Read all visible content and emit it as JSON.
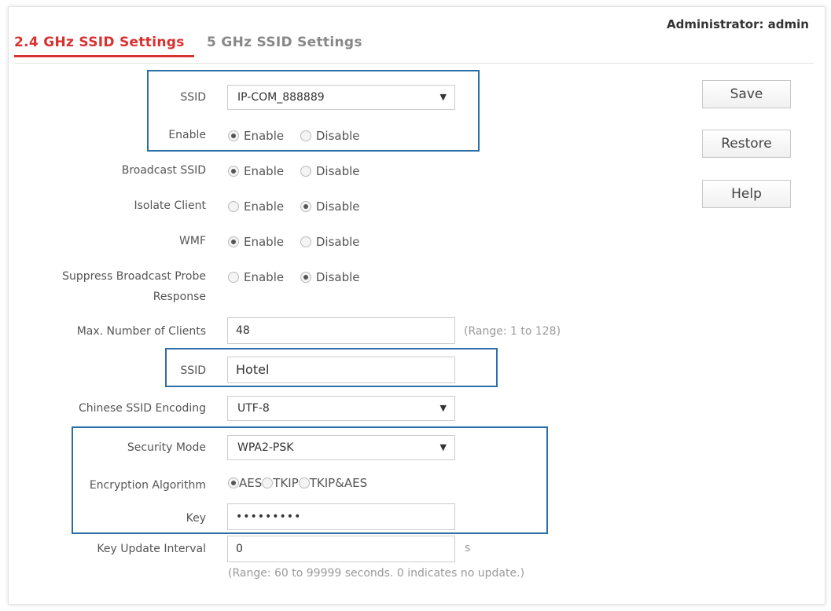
{
  "header": {
    "admin_text": "Administrator: admin"
  },
  "tabs": [
    {
      "label": "2.4 GHz SSID Settings",
      "active": true
    },
    {
      "label": "5 GHz SSID Settings",
      "active": false
    }
  ],
  "form": {
    "ssid_select": {
      "label": "SSID",
      "value": "IP-COM_888889"
    },
    "enable": {
      "label": "Enable",
      "options": [
        "Enable",
        "Disable"
      ],
      "selected": "Enable"
    },
    "broadcast_ssid": {
      "label": "Broadcast SSID",
      "options": [
        "Enable",
        "Disable"
      ],
      "selected": "Enable"
    },
    "isolate_client": {
      "label": "Isolate Client",
      "options": [
        "Enable",
        "Disable"
      ],
      "selected": "Disable"
    },
    "wmf": {
      "label": "WMF",
      "options": [
        "Enable",
        "Disable"
      ],
      "selected": "Enable"
    },
    "suppress_probe": {
      "label_line1": "Suppress Broadcast Probe",
      "label_line2": "Response",
      "options": [
        "Enable",
        "Disable"
      ],
      "selected": "Disable"
    },
    "max_clients": {
      "label": "Max. Number of Clients",
      "value": "48",
      "hint": "(Range: 1 to 128)"
    },
    "ssid_name": {
      "label": "SSID",
      "value": "Hotel"
    },
    "chinese_encoding": {
      "label": "Chinese SSID Encoding",
      "value": "UTF-8"
    },
    "security_mode": {
      "label": "Security Mode",
      "value": "WPA2-PSK"
    },
    "encryption": {
      "label": "Encryption Algorithm",
      "options": [
        "AES",
        "TKIP",
        "TKIP&AES"
      ],
      "selected": "AES"
    },
    "key": {
      "label": "Key",
      "value": "•••••••••"
    },
    "key_update": {
      "label": "Key Update Interval",
      "value": "0",
      "unit": "s",
      "hint": "(Range: 60 to 99999 seconds. 0 indicates no update.)"
    }
  },
  "buttons": {
    "save": "Save",
    "restore": "Restore",
    "help": "Help"
  },
  "colors": {
    "accent": "#d9312f",
    "highlight_box": "#2b6ea8"
  },
  "icons": {
    "dropdown": "▼"
  }
}
